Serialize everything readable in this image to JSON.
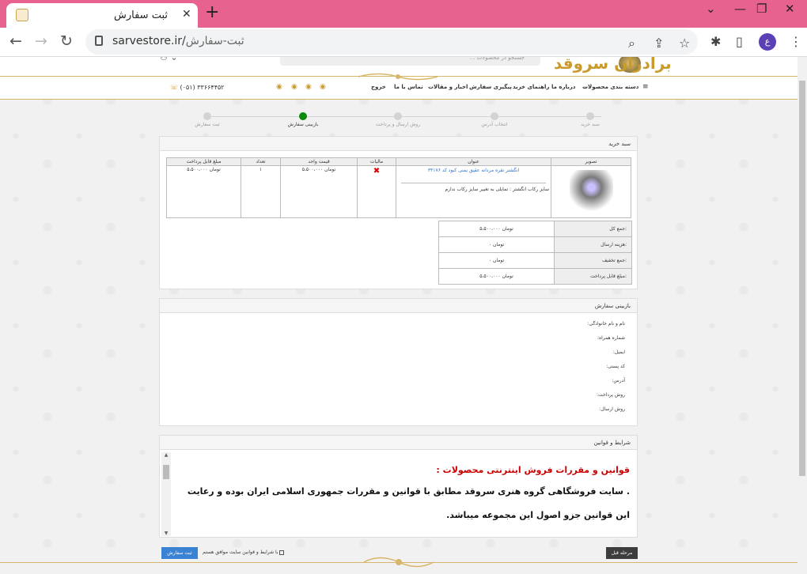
{
  "browser": {
    "tab_title": "ثبت سفارش",
    "url_host": "sarvestore.ir/",
    "url_path": "ثبت-سفارش",
    "profile_initial": "ع"
  },
  "site": {
    "brand": "برادران سروقد",
    "search_placeholder": "جستجو در محصولات ...",
    "phone": "(۰۵۱) ۳۳۶۶۴۴۵۲",
    "nav": [
      "دسته بندی محصولات",
      "درباره ما",
      "راهنمای خرید",
      "پیگیری سفارش",
      "اخبار و مقالات",
      "تماس با ما",
      "خروج"
    ]
  },
  "steps": [
    "سبد خرید",
    "انتخاب آدرس",
    "روش ارسال و پرداخت",
    "بازبینی سفارش",
    "ثبت سفارش"
  ],
  "cart": {
    "title": "سبد خرید",
    "headers": [
      "تصویر",
      "عنوان",
      "مالیات",
      "قیمت واحد",
      "تعداد",
      "مبلغ قابل پرداخت"
    ],
    "product_title": "انگشتر نقره مردانه عقیق یمنی کبود کد ۳۴۱۷۶",
    "product_option": "سایز رکاب انگشتر : تمایلی به تغییر سایز رکاب ندارم",
    "unit_price": "۵،۵۰۰،۰۰۰ تومان",
    "qty": "۱",
    "line_total": "۵،۵۰۰،۰۰۰ تومان",
    "summary": [
      {
        "label": "جمع کل:",
        "value": "۵،۵۰۰،۰۰۰ تومان"
      },
      {
        "label": "هزینه ارسال:",
        "value": "۰ تومان"
      },
      {
        "label": "جمع تخفیف:",
        "value": "۰ تومان"
      },
      {
        "label": "مبلغ قابل پرداخت:",
        "value": "۵،۵۰۰،۰۰۰ تومان"
      }
    ]
  },
  "review": {
    "title": "بازبینی سفارش",
    "fields": [
      "نام و نام خانوادگی:",
      "شماره همراه:",
      "ایمیل:",
      "کد پستی:",
      "آدرس:",
      "روش پرداخت:",
      "روش ارسال:"
    ]
  },
  "terms": {
    "title": "شرایط و قوانین",
    "heading": "قوانین و مقررات فروش اینترنتی محصولات :",
    "body": ". سایت فروشگاهی گروه هنری سروقد مطابق با قوانین و مقررات جمهوری اسلامی ایران بوده و رعایت این قوانین جزو اصول این مجموعه میباشد."
  },
  "actions": {
    "prev": "مرحله قبل",
    "submit": "ثبت سفارش",
    "agree": "با شرایط و قوانین سایت موافق هستم"
  }
}
